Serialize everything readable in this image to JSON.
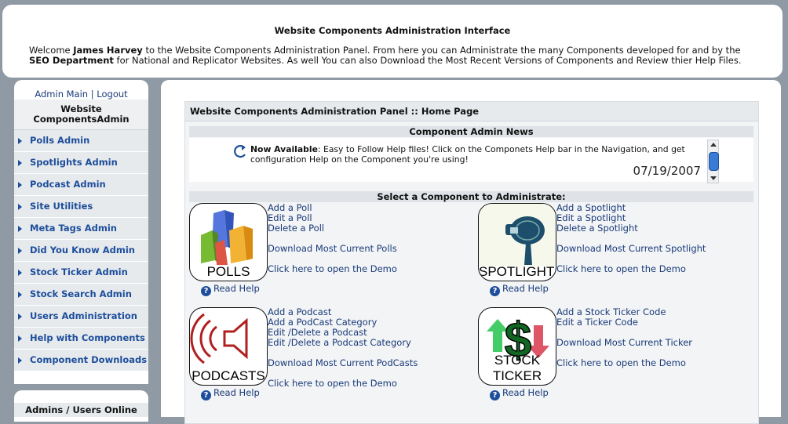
{
  "header": {
    "title": "Website Components Administration Interface",
    "welcome_prefix": "Welcome ",
    "user": "James Harvey",
    "welcome_mid": " to the Website Components Administration Panel. From here you can Administrate the many Components developed for and by the ",
    "department": "SEO Department",
    "welcome_suffix": " for National and Replicator Websites. As well You can also Download the Most Recent Versions of Components and Review thier Help Files."
  },
  "sidebar": {
    "admin_main": "Admin Main",
    "separator": " | ",
    "logout": "Logout",
    "title_line1": "Website",
    "title_line2": "ComponentsAdmin",
    "items": [
      {
        "label": "Polls Admin"
      },
      {
        "label": "Spotlights Admin"
      },
      {
        "label": "Podcast Admin"
      },
      {
        "label": "Site Utilities"
      },
      {
        "label": "Meta Tags Admin"
      },
      {
        "label": "Did You Know Admin"
      },
      {
        "label": "Stock Ticker Admin"
      },
      {
        "label": "Stock Search Admin"
      },
      {
        "label": "Users Administration"
      },
      {
        "label": "Help with Components"
      },
      {
        "label": "Component Downloads"
      }
    ],
    "online_title": "Admins / Users Online"
  },
  "panel": {
    "title": "Website Components Administration Panel :: Home Page",
    "news_title": "Component Admin News",
    "news_strong": "Now Available",
    "news_text": ": Easy to Follow Help files! Click on the Componets Help bar in the Navigation, and get configuration Help on the Component you're using!",
    "news_date": "07/19/2007",
    "select_title": "Select a Component to Administrate:"
  },
  "components": {
    "polls": {
      "icon_label": "POLLS",
      "links": [
        "Add a Poll",
        "Edit a Poll",
        "Delete a Poll"
      ],
      "download": "Download Most Current Polls",
      "demo": "Click here to open the Demo",
      "help": "Read Help"
    },
    "spotlights": {
      "icon_label": "SPOTLIGHTS",
      "links": [
        "Add a Spotlight",
        "Edit a Spotlight",
        "Delete a Spotlight"
      ],
      "download": "Download Most Current Spotlight",
      "demo": "Click here to open the Demo",
      "help": "Read Help"
    },
    "podcasts": {
      "icon_label": "PODCASTS",
      "links": [
        "Add a Podcast",
        "Add a PodCast Category",
        "Edit /Delete a Podcast",
        "Edit /Delete a Podcast Category"
      ],
      "download": "Download Most Current PodCasts",
      "demo": "Click here to open the Demo",
      "help": "Read Help"
    },
    "ticker": {
      "icon_label": "STOCK TICKER",
      "links": [
        "Add a Stock Ticker Code",
        "Edit a Ticker Code"
      ],
      "download": "Download Most Current Ticker",
      "demo": "Click here to open the Demo",
      "help": "Read Help"
    }
  },
  "colors": {
    "background": "#8f9aa4",
    "link": "#1a3a78",
    "menu_text": "#1d4e9b",
    "menu_bg": "#e7eaed"
  }
}
